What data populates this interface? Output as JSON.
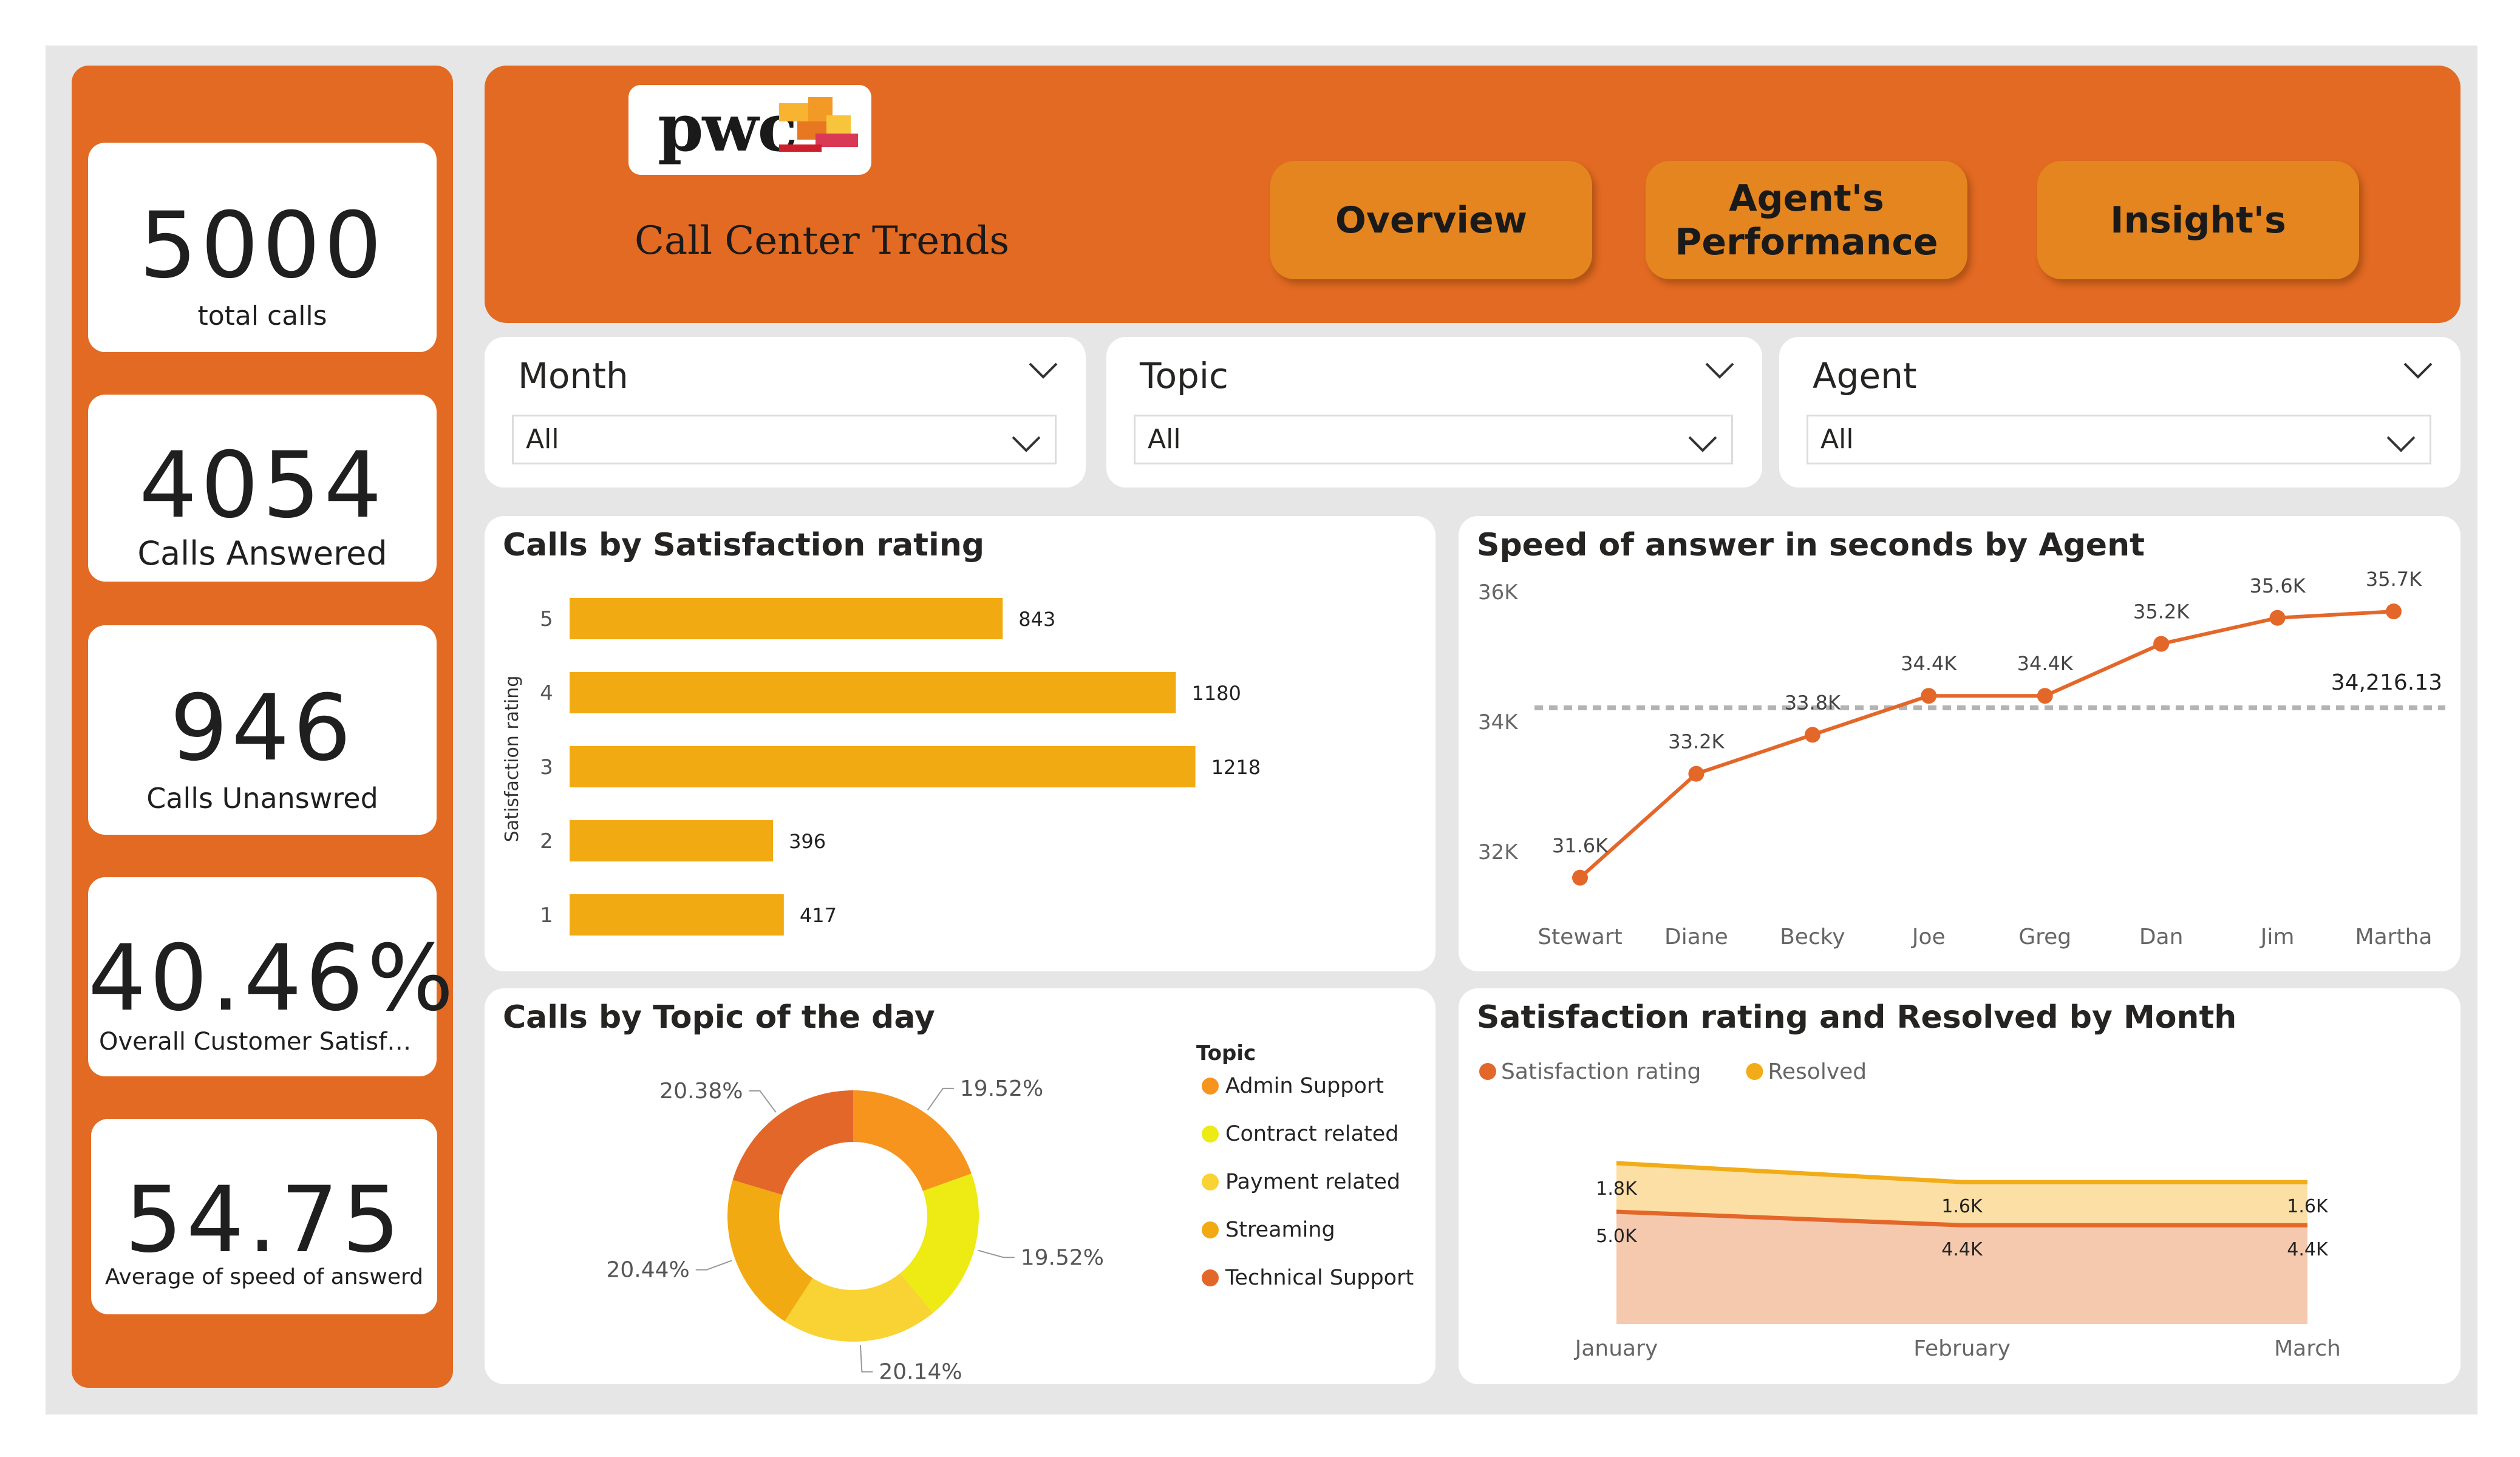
{
  "kpis": [
    {
      "value": "5000",
      "label": "total calls"
    },
    {
      "value": "4054",
      "label": "Calls Answered"
    },
    {
      "value": "946",
      "label": "Calls Unanswred"
    },
    {
      "value": "40.46%",
      "label": "Overall Customer Satisfati..."
    },
    {
      "value": "54.75",
      "label": "Average of speed of answerd"
    }
  ],
  "header": {
    "logo_text": "pwc",
    "title": "Call Center Trends",
    "nav": [
      "Overview",
      "Agent's Performance",
      "Insight's"
    ]
  },
  "slicers": [
    {
      "title": "Month",
      "value": "All"
    },
    {
      "title": "Topic",
      "value": "All"
    },
    {
      "title": "Agent",
      "value": "All"
    }
  ],
  "colors": {
    "brand_orange": "#e26a22",
    "bar_yellow": "#f2aa13",
    "line_orange": "#e4672a",
    "area_orange": "#f5c9ae",
    "area_yellow": "#fbdfa4",
    "line_yellow": "#f2ac17"
  },
  "chart_data": [
    {
      "type": "bar",
      "title": "Calls by Satisfaction rating",
      "ylabel": "Satisfaction rating",
      "categories": [
        "5",
        "4",
        "3",
        "2",
        "1"
      ],
      "values": [
        843,
        1180,
        1218,
        396,
        417
      ],
      "xlim": [
        0,
        1300
      ]
    },
    {
      "type": "line",
      "title": "Speed of answer in seconds by Agent",
      "x": [
        "Stewart",
        "Diane",
        "Becky",
        "Joe",
        "Greg",
        "Dan",
        "Jim",
        "Martha"
      ],
      "values": [
        31.6,
        33.2,
        33.8,
        34.4,
        34.4,
        35.2,
        35.6,
        35.7
      ],
      "data_labels": [
        "31.6K",
        "33.2K",
        "33.8K",
        "34.4K",
        "34.4K",
        "35.2K",
        "35.6K",
        "35.7K"
      ],
      "ylim": [
        31,
        36
      ],
      "yticks": [
        "36K",
        "34K",
        "32K"
      ],
      "yticks_values": [
        36,
        34,
        32
      ],
      "reference_value": 34.21613,
      "reference_label": "34,216.13"
    },
    {
      "type": "pie",
      "title": "Calls by Topic of the day",
      "legend_title": "Topic",
      "categories": [
        "Admin Support",
        "Contract related",
        "Payment related",
        "Streaming",
        "Technical Support"
      ],
      "values": [
        19.52,
        19.52,
        20.14,
        20.44,
        20.38
      ],
      "labels": [
        "19.52%",
        "19.52%",
        "20.14%",
        "20.44%",
        "20.38%"
      ],
      "colors": [
        "#f7941d",
        "#eeea13",
        "#f9d334",
        "#f2aa13",
        "#e4672a"
      ]
    },
    {
      "type": "area",
      "title": "Satisfaction rating and Resolved by Month",
      "x": [
        "January",
        "February",
        "March"
      ],
      "series": [
        {
          "name": "Satisfaction rating",
          "values": [
            5.0,
            4.4,
            4.4
          ],
          "labels": [
            "5.0K",
            "4.4K",
            "4.4K"
          ],
          "color": "#e4672a"
        },
        {
          "name": "Resolved",
          "values": [
            1.8,
            1.6,
            1.6
          ],
          "labels": [
            "1.8K",
            "1.6K",
            "1.6K"
          ],
          "color": "#f2ac17"
        }
      ]
    }
  ]
}
